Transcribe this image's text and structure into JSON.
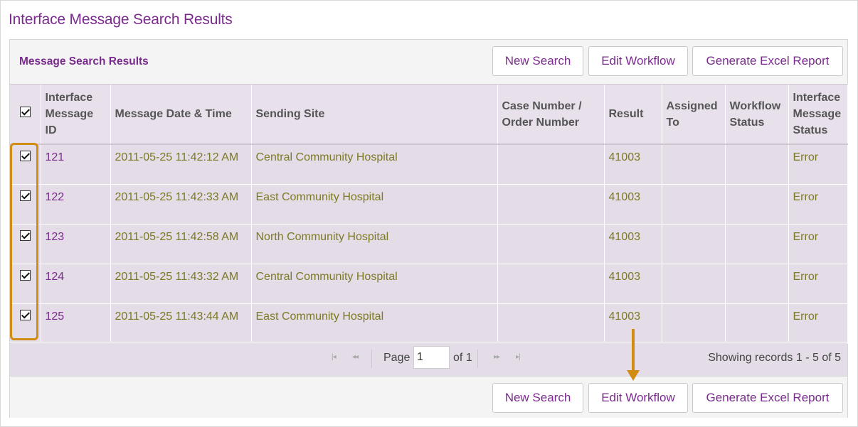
{
  "page": {
    "title": "Interface Message Search Results"
  },
  "panel": {
    "title": "Message Search Results"
  },
  "buttons": {
    "new_search": "New Search",
    "edit_workflow": "Edit Workflow",
    "generate_excel": "Generate Excel Report"
  },
  "table": {
    "header_select_all_checked": true,
    "columns": [
      "Interface Message ID",
      "Message Date & Time",
      "Sending Site",
      "Case Number / Order Number",
      "Result",
      "Assigned To",
      "Workflow Status",
      "Interface Message Status"
    ],
    "rows": [
      {
        "checked": true,
        "id": "121",
        "datetime": "2011-05-25 11:42:12 AM",
        "site": "Central Community Hospital",
        "case": "",
        "result": "41003",
        "assigned": "",
        "workflow": "",
        "status": "Error"
      },
      {
        "checked": true,
        "id": "122",
        "datetime": "2011-05-25 11:42:33 AM",
        "site": "East Community Hospital",
        "case": "",
        "result": "41003",
        "assigned": "",
        "workflow": "",
        "status": "Error"
      },
      {
        "checked": true,
        "id": "123",
        "datetime": "2011-05-25 11:42:58 AM",
        "site": "North Community Hospital",
        "case": "",
        "result": "41003",
        "assigned": "",
        "workflow": "",
        "status": "Error"
      },
      {
        "checked": true,
        "id": "124",
        "datetime": "2011-05-25 11:43:32 AM",
        "site": "Central Community Hospital",
        "case": "",
        "result": "41003",
        "assigned": "",
        "workflow": "",
        "status": "Error"
      },
      {
        "checked": true,
        "id": "125",
        "datetime": "2011-05-25 11:43:44 AM",
        "site": "East Community Hospital",
        "case": "",
        "result": "41003",
        "assigned": "",
        "workflow": "",
        "status": "Error"
      }
    ]
  },
  "pager": {
    "page_label": "Page",
    "page_value": "1",
    "of_label": "of 1",
    "showing": "Showing records 1 - 5 of 5",
    "first_icon": "first-page-icon",
    "prev_icon": "prev-page-icon",
    "next_icon": "next-page-icon",
    "last_icon": "last-page-icon"
  },
  "colors": {
    "accent": "#7a2a8c",
    "olive_text": "#7b7b24",
    "highlight": "#d18c13",
    "grid_bg": "#e4dce6"
  }
}
